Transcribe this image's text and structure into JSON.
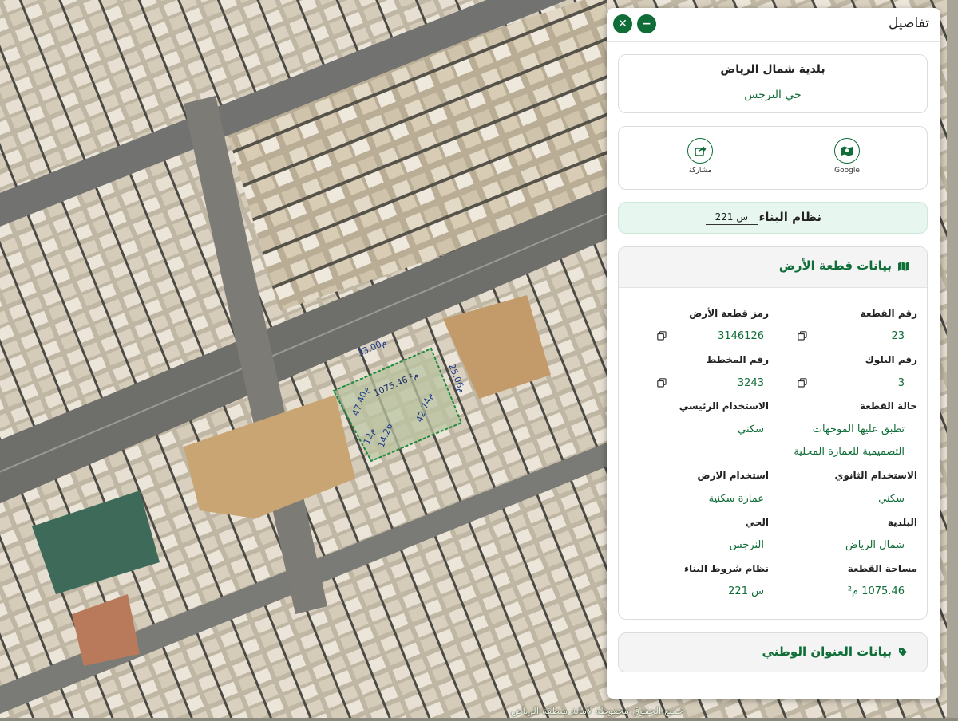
{
  "panel": {
    "title": "تفاصيل",
    "close_icon": "close-icon",
    "minimize_icon": "minimize-icon"
  },
  "municipality": {
    "name": "بلدية شمال الرياض",
    "district": "حي النرجس"
  },
  "actions": {
    "google_label": "Google",
    "share_label": "مشاركة"
  },
  "building_system": {
    "title": "نظام البناء",
    "value": "س 221"
  },
  "land": {
    "title": "بيانات قطعة الأرض",
    "fields": {
      "plot_number_label": "رقم القطعة",
      "plot_number": "23",
      "plot_code_label": "رمز قطعة الأرض",
      "plot_code": "3146126",
      "block_number_label": "رقم البلوك",
      "block_number": "3",
      "plan_number_label": "رقم المخطط",
      "plan_number": "3243",
      "plot_status_label": "حالة القطعة",
      "plot_status_line1": "تطبق عليها الموجهات",
      "plot_status_line2": "التصميمية للعمارة المحلية",
      "main_use_label": "الاستخدام الرئيسي",
      "main_use": "سكني",
      "secondary_use_label": "الاستخدام الثانوي",
      "secondary_use": "سكني",
      "land_use_label": "استخدام الارض",
      "land_use": "عمارة سكنية",
      "municipality_label": "البلدية",
      "municipality": "شمال الرياض",
      "district_label": "الحي",
      "district": "النرجس",
      "area_label": "مساحة القطعة",
      "area": "1075.46 م²",
      "building_code_label": "نظام شروط البناء",
      "building_code": "س 221"
    }
  },
  "address": {
    "title": "بيانات العنوان الوطني"
  },
  "map": {
    "attribution": "جميع الحقوق محفوظة لأمانة منطقة الرياض",
    "plot": {
      "side_top": "33.00م",
      "side_right": "25.06م",
      "side_left": "47.40م",
      "side_bottom_right": "42.74م",
      "side_bottom_left": "12م",
      "inner_dim": "14.26",
      "area": "1075.46 م²"
    }
  },
  "colors": {
    "brand_green": "#0f6d37",
    "building_system_bg": "#e7f6ee",
    "plot_outline": "#1e8a3c"
  }
}
